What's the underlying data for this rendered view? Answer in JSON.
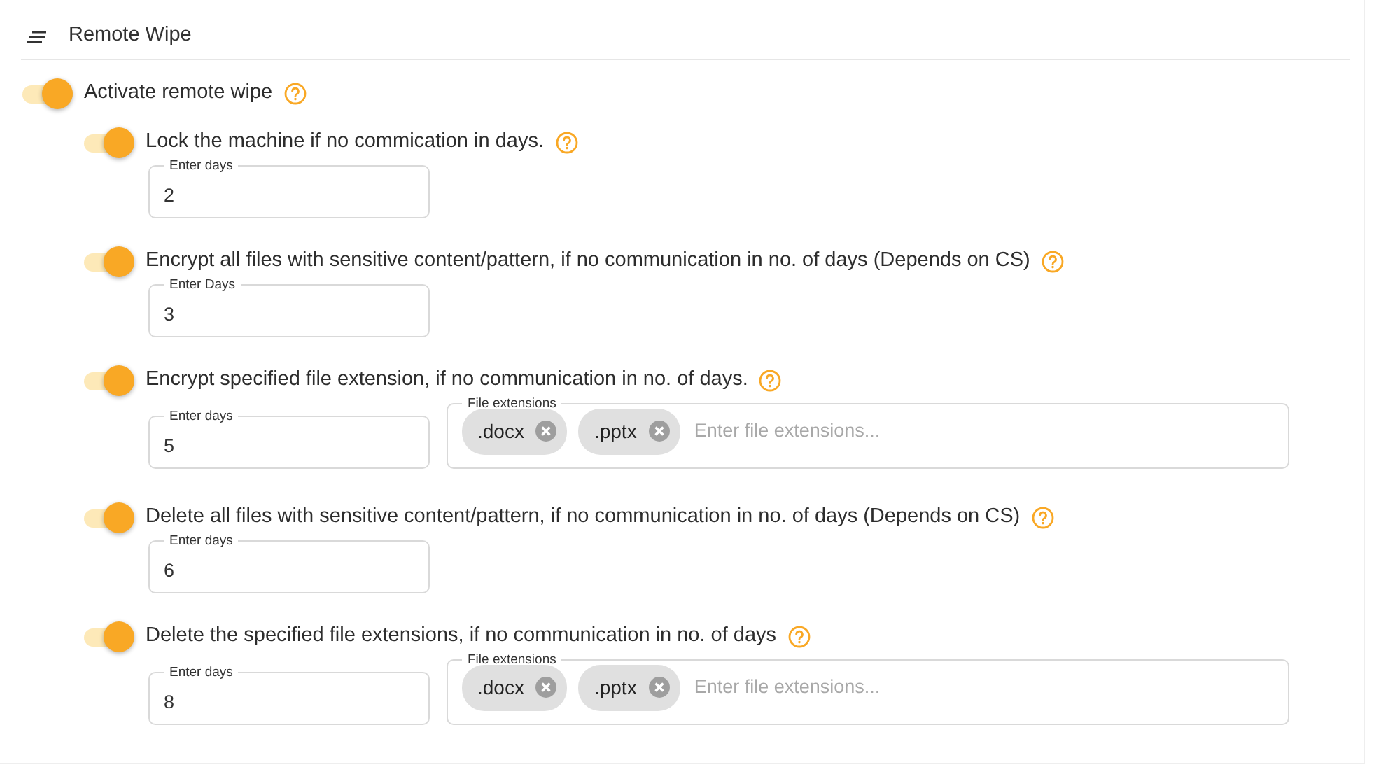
{
  "header": {
    "title": "Remote Wipe"
  },
  "main_option": {
    "label": "Activate remote wipe",
    "on": true
  },
  "options": [
    {
      "label": "Lock the machine if no commication in days.",
      "on": true,
      "days": {
        "label": "Enter days",
        "value": "2"
      }
    },
    {
      "label": "Encrypt all files with sensitive content/pattern, if no communication in no. of days (Depends on CS)",
      "on": true,
      "days": {
        "label": "Enter Days",
        "value": "3"
      }
    },
    {
      "label": "Encrypt specified file extension, if no communication in no. of days.",
      "on": true,
      "days": {
        "label": "Enter days",
        "value": "5"
      },
      "extensions": {
        "label": "File extensions",
        "chips": [
          ".docx",
          ".pptx"
        ],
        "placeholder": "Enter file extensions..."
      }
    },
    {
      "label": "Delete all files with sensitive content/pattern, if no communication in no. of days (Depends on CS)",
      "on": true,
      "days": {
        "label": "Enter days",
        "value": "6"
      }
    },
    {
      "label": "Delete the specified file extensions, if no communication in no. of days",
      "on": true,
      "days": {
        "label": "Enter days",
        "value": "8"
      },
      "extensions": {
        "label": "File extensions",
        "chips": [
          ".docx",
          ".pptx"
        ],
        "placeholder": "Enter file extensions..."
      }
    }
  ]
}
